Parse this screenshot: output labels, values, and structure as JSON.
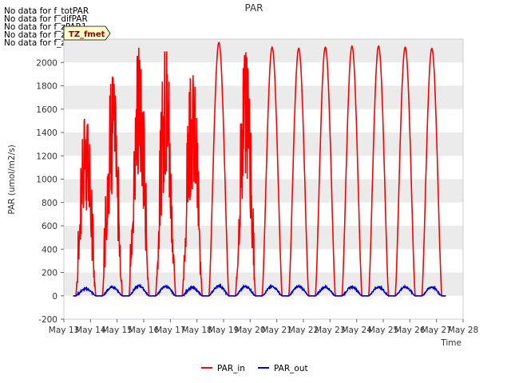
{
  "no_data_messages": [
    "No data for f_totPAR",
    "No data for f_difPAR",
    "No data for f_zPAR1",
    "No data for f_zPAR2",
    "No data for f_zPAR3"
  ],
  "site_badge": "TZ_fmet",
  "colors": {
    "PAR_in": "#ff0000",
    "PAR_out": "#0000cc",
    "band": "#ebebeb"
  },
  "chart_data": {
    "type": "line",
    "title": "PAR",
    "xlabel": "Time",
    "ylabel": "PAR (umol/m2/s)",
    "ylim": [
      -200,
      2200
    ],
    "yticks": [
      -200,
      0,
      200,
      400,
      600,
      800,
      1000,
      1200,
      1400,
      1600,
      1800,
      2000
    ],
    "x_range_days": [
      13,
      28
    ],
    "xtick_days": [
      13,
      14,
      15,
      16,
      17,
      18,
      19,
      20,
      21,
      22,
      23,
      24,
      25,
      26,
      27,
      28
    ],
    "xtick_labels": [
      "May 13",
      "May 14",
      "May 15",
      "May 16",
      "May 17",
      "May 18",
      "May 19",
      "May 20",
      "May 21",
      "May 22",
      "May 23",
      "May 24",
      "May 25",
      "May 26",
      "May 27",
      "May 28"
    ],
    "grid": "alternating horizontal bands",
    "legend_position": "bottom-center",
    "series": [
      {
        "name": "PAR_in",
        "daily_peaks": [
          {
            "day": "May 14",
            "peak": 1550
          },
          {
            "day": "May 15",
            "peak": 1880
          },
          {
            "day": "May 16",
            "peak": 2130
          },
          {
            "day": "May 17",
            "peak": 2120
          },
          {
            "day": "May 18",
            "peak": 1960
          },
          {
            "day": "May 19",
            "peak": 2170
          },
          {
            "day": "May 20",
            "peak": 2090
          },
          {
            "day": "May 21",
            "peak": 2130
          },
          {
            "day": "May 22",
            "peak": 2120
          },
          {
            "day": "May 23",
            "peak": 2130
          },
          {
            "day": "May 24",
            "peak": 2140
          },
          {
            "day": "May 25",
            "peak": 2140
          },
          {
            "day": "May 26",
            "peak": 2130
          },
          {
            "day": "May 27",
            "peak": 2120
          }
        ]
      },
      {
        "name": "PAR_out",
        "daily_peaks": [
          {
            "day": "May 14",
            "peak": 60
          },
          {
            "day": "May 15",
            "peak": 75
          },
          {
            "day": "May 16",
            "peak": 85
          },
          {
            "day": "May 17",
            "peak": 80
          },
          {
            "day": "May 18",
            "peak": 70
          },
          {
            "day": "May 19",
            "peak": 85
          },
          {
            "day": "May 20",
            "peak": 80
          },
          {
            "day": "May 21",
            "peak": 80
          },
          {
            "day": "May 22",
            "peak": 80
          },
          {
            "day": "May 23",
            "peak": 75
          },
          {
            "day": "May 24",
            "peak": 75
          },
          {
            "day": "May 25",
            "peak": 75
          },
          {
            "day": "May 26",
            "peak": 75
          },
          {
            "day": "May 27",
            "peak": 75
          }
        ]
      }
    ]
  }
}
